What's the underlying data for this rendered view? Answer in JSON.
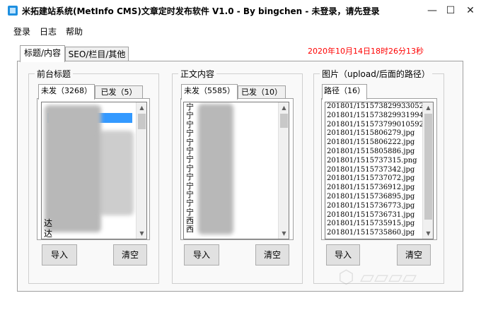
{
  "window": {
    "title": "米拓建站系统(MetInfo CMS)文章定时发布软件 V1.0 - By bingchen - 未登录，请先登录",
    "controls": [
      "—",
      "☐",
      "✕"
    ]
  },
  "menu": [
    "登录",
    "日志",
    "帮助"
  ],
  "outer_tabs": [
    "标题/内容",
    "SEO/栏目/其他"
  ],
  "timestamp": "2020年10月14日18时26分13秒",
  "groups": {
    "titles": {
      "label": "前台标题",
      "tabs": [
        "未发（3268）",
        "已发（5）"
      ],
      "import": "导入",
      "clear": "清空"
    },
    "content": {
      "label": "正文内容",
      "tabs": [
        "未发（5585）",
        "已发（10）"
      ],
      "import": "导入",
      "clear": "清空"
    },
    "images": {
      "label": "图片（upload/后面的路径）",
      "tabs": [
        "路径（16）"
      ],
      "paths": [
        "201801/151573829933052",
        "201801/151573829931994",
        "201801/151573799010592",
        "201801/1515806279.jpg",
        "201801/1515806222.jpg",
        "201801/1515805886.jpg",
        "201801/1515737315.png",
        "201801/1515737342.jpg",
        "201801/1515737072.jpg",
        "201801/1515736912.jpg",
        "201801/1515736895.jpg",
        "201801/1515736773.jpg",
        "201801/1515736731.jpg",
        "201801/1515735915.jpg",
        "201801/1515735860.jpg"
      ],
      "import": "导入",
      "clear": "清空"
    }
  },
  "content_list_visible_chars": [
    "宁",
    "宁",
    "宁",
    "宁",
    "宁",
    "宁",
    "宁",
    "宁",
    "宁",
    "宁",
    "宁",
    "宁",
    "宁",
    "西",
    "西"
  ],
  "titles_list_visible_chars": [
    "达",
    "达"
  ],
  "colors": {
    "timestamp": "#ff0000",
    "selection": "#3399ff"
  }
}
